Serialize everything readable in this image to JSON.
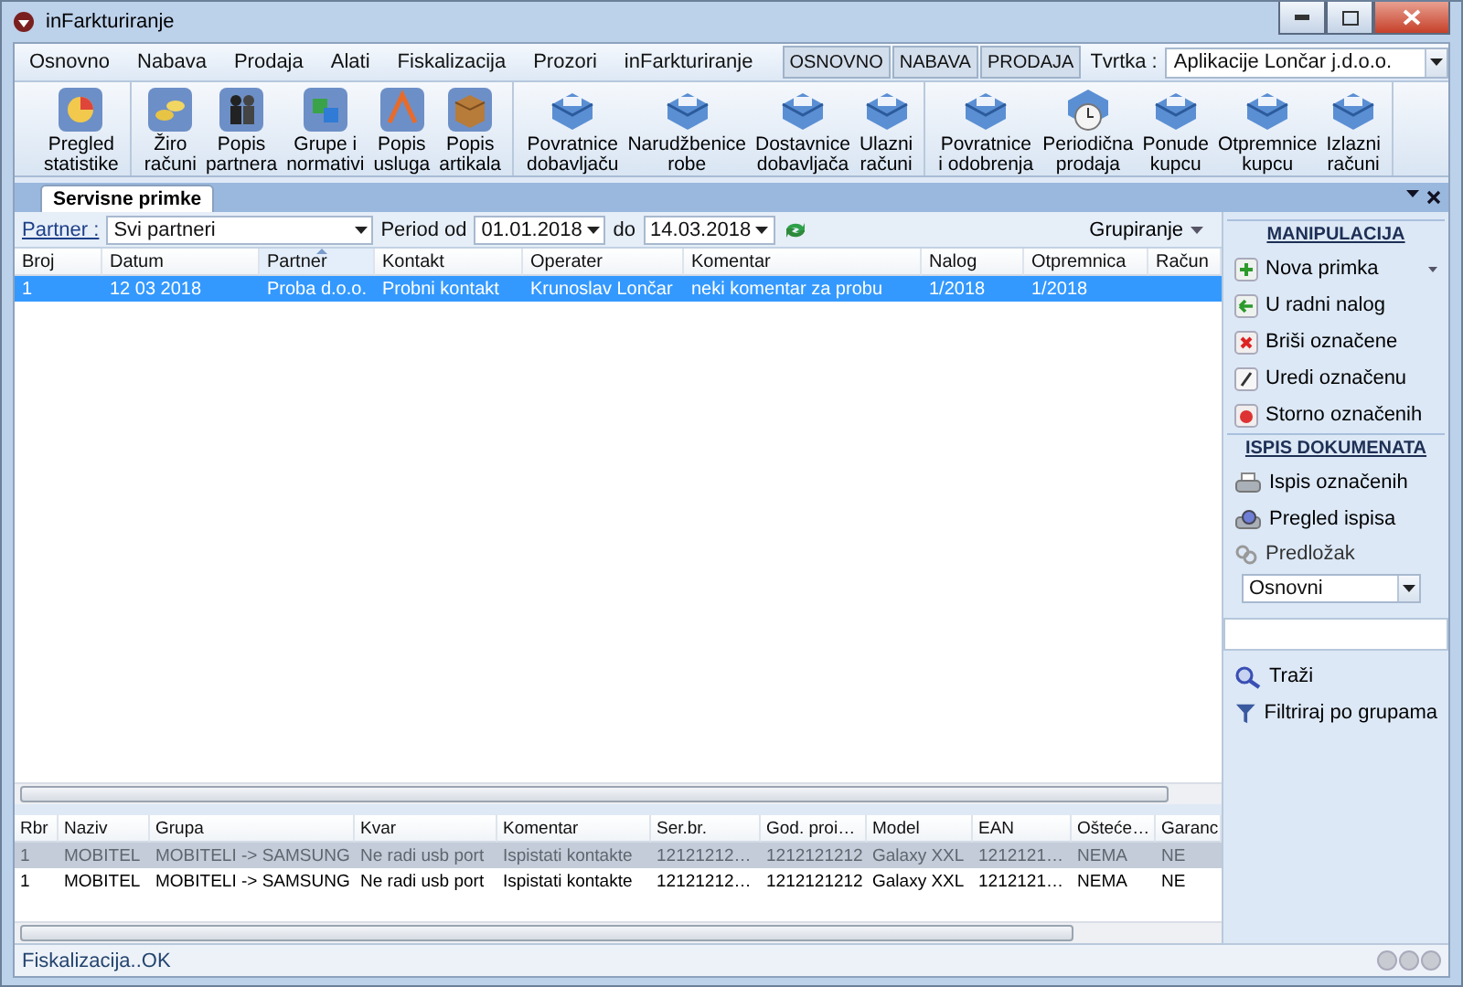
{
  "window": {
    "title": "inFarkturiranje"
  },
  "menu": [
    "Osnovno",
    "Nabava",
    "Prodaja",
    "Alati",
    "Fiskalizacija",
    "Prozori",
    "inFarkturiranje"
  ],
  "modes": [
    "OSNOVNO",
    "NABAVA",
    "PRODAJA"
  ],
  "company": {
    "label": "Tvrtka :",
    "value": "Aplikacije Lončar j.d.o.o."
  },
  "toolbar": [
    [
      "Pregled\nstatistike"
    ],
    [
      "Žiro\nračuni",
      "Popis\npartnera",
      "Grupe i\nnormativi",
      "Popis\nusluga",
      "Popis\nartikala"
    ],
    [
      "Povratnice\ndobavljaču",
      "Narudžbenice\nrobe",
      "Dostavnice\ndobavljača",
      "Ulazni\nračuni"
    ],
    [
      "Povratnice\ni odobrenja",
      "Periodična\nprodaja",
      "Ponude\nkupcu",
      "Otpremnice\nkupcu",
      "Izlazni\nračuni"
    ]
  ],
  "tab": {
    "label": "Servisne primke"
  },
  "filter": {
    "partner_label": "Partner :",
    "partner": "Svi partneri",
    "period_label": "Period od",
    "from": "01.01.2018",
    "to_label": "do",
    "to": "14.03.2018",
    "grouping": "Grupiranje"
  },
  "table": {
    "columns": [
      {
        "label": "Broj",
        "sorted": false
      },
      {
        "label": "Datum",
        "sorted": false
      },
      {
        "label": "Partner",
        "sorted": true
      },
      {
        "label": "Kontakt",
        "sorted": false
      },
      {
        "label": "Operater",
        "sorted": false
      },
      {
        "label": "Komentar",
        "sorted": false
      },
      {
        "label": "Nalog",
        "sorted": false
      },
      {
        "label": "Otpremnica",
        "sorted": false
      },
      {
        "label": "Račun",
        "sorted": false
      }
    ],
    "rows": [
      {
        "selected": true,
        "cells": [
          "1",
          "12 03 2018",
          "Proba d.o.o.",
          "Probni kontakt",
          "Krunoslav Lončar",
          "neki komentar za probu",
          "1/2018",
          "1/2018",
          ""
        ]
      }
    ]
  },
  "items_table": {
    "columns": [
      "Rbr",
      "Naziv",
      "Grupa",
      "Kvar",
      "Komentar",
      "Ser.br.",
      "God. proi…",
      "Model",
      "EAN",
      "Oštećе…",
      "Garanc"
    ],
    "rows": [
      {
        "selected": true,
        "cells": [
          "1",
          "MOBITEL",
          "MOBITELI -> SAMSUNG",
          "Ne radi usb port",
          "Ispistati kontakte",
          "12121212…",
          "1212121212",
          "Galaxy XXL",
          "1212121…",
          "NEMA",
          "NE"
        ]
      },
      {
        "selected": false,
        "cells": [
          "1",
          "MOBITEL",
          "MOBITELI -> SAMSUNG",
          "Ne radi usb port",
          "Ispistati kontakte",
          "12121212…",
          "1212121212",
          "Galaxy XXL",
          "1212121…",
          "NEMA",
          "NE"
        ]
      }
    ]
  },
  "side_panel": {
    "sections": [
      {
        "title": "MANIPULACIJA",
        "items": [
          {
            "label": "Nova primka",
            "menu": true
          },
          {
            "label": "U radni nalog",
            "menu": false
          },
          {
            "label": "Briši označene",
            "menu": false
          },
          {
            "label": "Uredi označenu",
            "menu": false
          },
          {
            "label": "Storno označenih",
            "menu": false
          }
        ]
      },
      {
        "title": "ISPIS DOKUMENATA",
        "items": [
          {
            "label": "Ispis označenih",
            "menu": false
          },
          {
            "label": "Pregled ispisa",
            "menu": false
          }
        ]
      }
    ],
    "template": {
      "label": "Predložak",
      "value": "Osnovni"
    },
    "search_items": [
      "Traži",
      "Filtriraj po grupama"
    ]
  },
  "status_bar": {
    "text": "Fiskalizacija..OK"
  }
}
